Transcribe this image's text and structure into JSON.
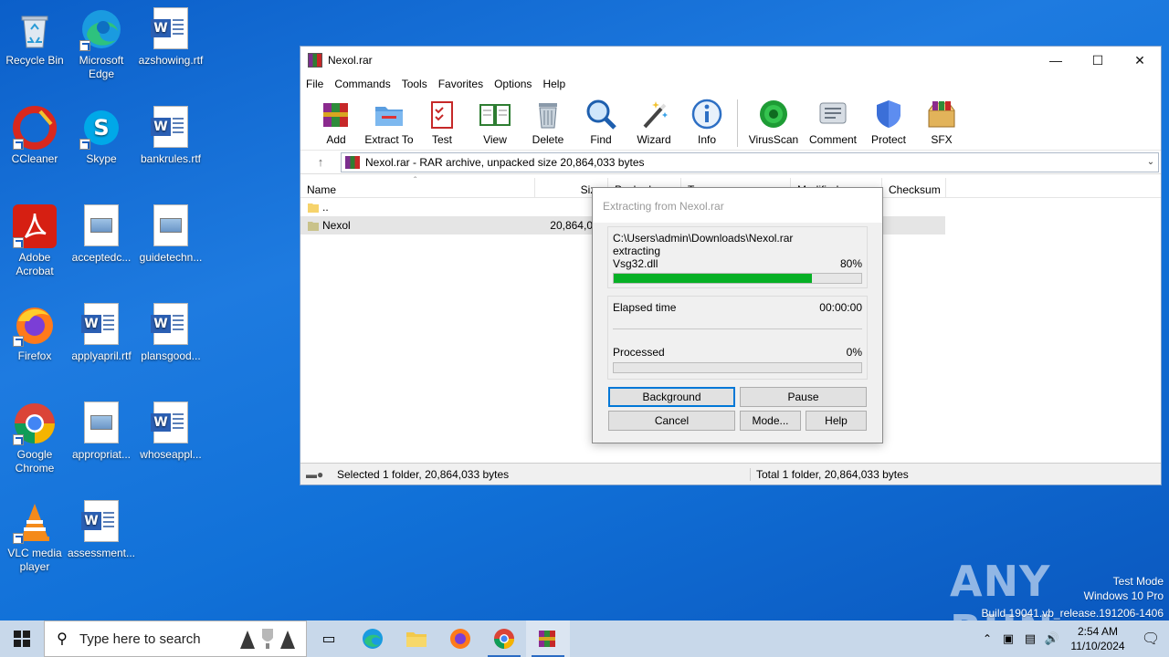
{
  "desktop": {
    "icons": [
      {
        "label": "Recycle Bin"
      },
      {
        "label": "Microsoft Edge"
      },
      {
        "label": "azshowing.rtf"
      },
      {
        "label": "CCleaner"
      },
      {
        "label": "Skype"
      },
      {
        "label": "bankrules.rtf"
      },
      {
        "label": "Adobe Acrobat"
      },
      {
        "label": "acceptedc..."
      },
      {
        "label": "guidetechn..."
      },
      {
        "label": "Firefox"
      },
      {
        "label": "applyapril.rtf"
      },
      {
        "label": "plansgood..."
      },
      {
        "label": "Google Chrome"
      },
      {
        "label": "appropriat..."
      },
      {
        "label": "whoseappl..."
      },
      {
        "label": "VLC media player"
      },
      {
        "label": "assessment..."
      }
    ]
  },
  "window": {
    "title": "Nexol.rar",
    "menu": [
      "File",
      "Commands",
      "Tools",
      "Favorites",
      "Options",
      "Help"
    ],
    "toolbar": [
      "Add",
      "Extract To",
      "Test",
      "View",
      "Delete",
      "Find",
      "Wizard",
      "Info",
      "VirusScan",
      "Comment",
      "Protect",
      "SFX"
    ],
    "address": "Nexol.rar - RAR archive, unpacked size 20,864,033 bytes",
    "columns": [
      "Name",
      "Size",
      "Packed",
      "Type",
      "Modified",
      "Checksum"
    ],
    "rows": [
      {
        "name": "..",
        "size": ""
      },
      {
        "name": "Nexol",
        "size": "20,864,0"
      }
    ],
    "status_left": "Selected 1 folder, 20,864,033 bytes",
    "status_right": "Total 1 folder, 20,864,033 bytes"
  },
  "dialog": {
    "title": "Extracting from Nexol.rar",
    "path": "C:\\Users\\admin\\Downloads\\Nexol.rar",
    "action": "extracting",
    "file": "Vsg32.dll",
    "file_percent": "80%",
    "file_progress": 0.8,
    "elapsed_label": "Elapsed time",
    "elapsed_value": "00:00:00",
    "processed_label": "Processed",
    "processed_value": "0%",
    "processed_progress": 0.0,
    "buttons": {
      "background": "Background",
      "pause": "Pause",
      "cancel": "Cancel",
      "mode": "Mode...",
      "help": "Help"
    }
  },
  "taskbar": {
    "search_placeholder": "Type here to search",
    "time": "2:54 AM",
    "date": "11/10/2024"
  },
  "watermark": {
    "line1": "Test Mode",
    "line2": "Windows 10 Pro",
    "line3": "Build 19041.vb_release.191206-1406",
    "brand": "ANY RUN"
  },
  "colors": {
    "progress": "#06b025",
    "accent": "#0078d7"
  }
}
